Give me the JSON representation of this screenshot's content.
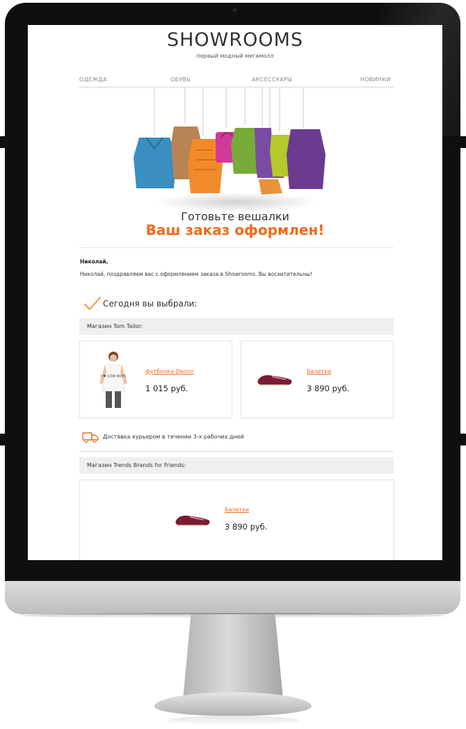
{
  "brand": {
    "name": "SHOWROOMS",
    "tagline": "первый модный мегамолл"
  },
  "nav": {
    "items": [
      "ОДЕЖДА",
      "ОБУВЬ",
      "АКСЕССУАРЫ",
      "НОВИНКИ"
    ]
  },
  "headline": {
    "line1": "Готовьте вешалки",
    "line2": "Ваш заказ оформлен!"
  },
  "greeting": {
    "name": "Николай,",
    "text": "Николай, поздравляем вас с оформлением заказа в Showrooms. Вы восхитительны!"
  },
  "chosen_title": "Сегодня вы выбрали:",
  "stores": [
    {
      "label": "Магазин Tom Tailor:",
      "products": [
        {
          "name": "футболка Denim",
          "price": "1 015 руб.",
          "image": "tshirt-model"
        },
        {
          "name": "Балетки",
          "price": "3 890 руб.",
          "image": "ballet-flat"
        }
      ]
    },
    {
      "label": "Магазин Trends Brands for Friends:",
      "products": [
        {
          "name": "Балетки",
          "price": "3 890 руб.",
          "image": "ballet-flat"
        }
      ]
    }
  ],
  "delivery": {
    "icon": "truck-icon",
    "text": "Доставка курьером в течении 3-х рабочих дней"
  },
  "tshirt_print": "I ♥ COW BOYS",
  "colors": {
    "accent": "#f26a1b",
    "store_bar": "#efefef",
    "bezel": "#0f0f10"
  }
}
